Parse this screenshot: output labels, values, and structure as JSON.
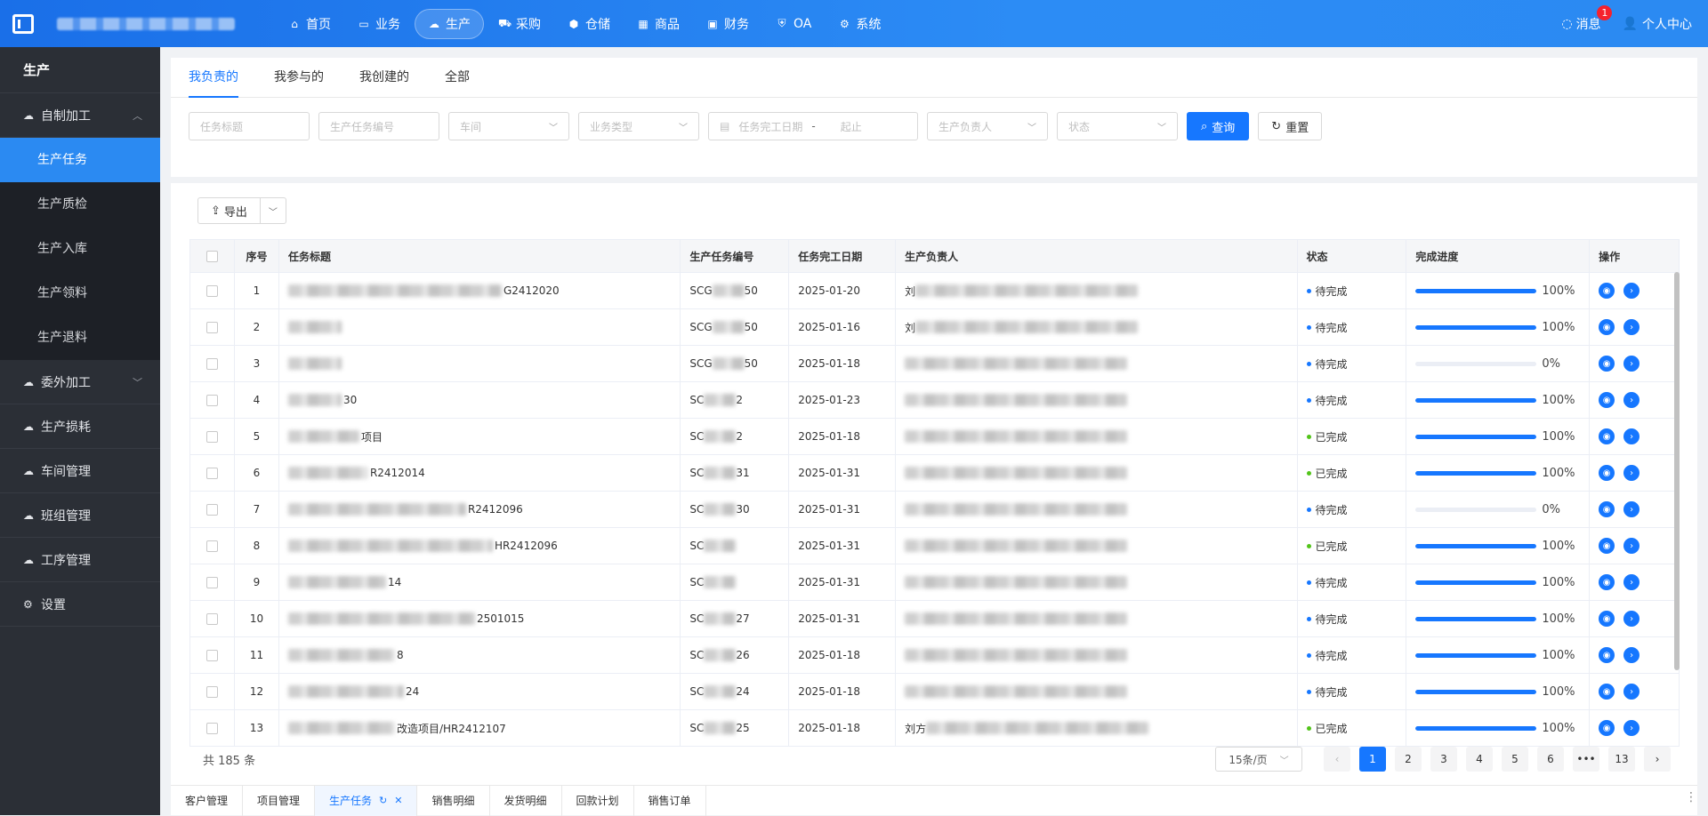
{
  "header": {
    "nav": [
      {
        "icon": "⌂",
        "label": "首页"
      },
      {
        "icon": "▭",
        "label": "业务"
      },
      {
        "icon": "☁",
        "label": "生产",
        "active": true
      },
      {
        "icon": "⛟",
        "label": "采购"
      },
      {
        "icon": "⬢",
        "label": "仓储"
      },
      {
        "icon": "▦",
        "label": "商品"
      },
      {
        "icon": "▣",
        "label": "财务"
      },
      {
        "icon": "⛨",
        "label": "OA"
      },
      {
        "icon": "⚙",
        "label": "系统"
      }
    ],
    "messages_label": "消息",
    "messages_badge": "1",
    "user_label": "个人中心"
  },
  "sidebar": {
    "title": "生产",
    "groups": [
      {
        "label": "自制加工",
        "expanded": true,
        "items": [
          "生产任务",
          "生产质检",
          "生产入库",
          "生产领料",
          "生产退料"
        ],
        "active_item": "生产任务"
      },
      {
        "label": "委外加工",
        "expanded": false
      },
      {
        "label": "生产损耗"
      },
      {
        "label": "车间管理"
      },
      {
        "label": "班组管理"
      },
      {
        "label": "工序管理"
      },
      {
        "label": "设置",
        "icon": "gear"
      }
    ]
  },
  "tabs": [
    {
      "label": "我负责的",
      "active": true
    },
    {
      "label": "我参与的"
    },
    {
      "label": "我创建的"
    },
    {
      "label": "全部"
    }
  ],
  "filters": {
    "task_title": "任务标题",
    "task_no": "生产任务编号",
    "workshop": "车间",
    "biz_type": "业务类型",
    "date_start": "任务完工日期",
    "date_sep": "-",
    "date_end": "起止",
    "owner": "生产负责人",
    "status": "状态",
    "query": "查询",
    "reset": "重置"
  },
  "export_label": "导出",
  "table": {
    "headers": [
      "序号",
      "任务标题",
      "生产任务编号",
      "任务完工日期",
      "生产负责人",
      "状态",
      "完成进度",
      "操作"
    ],
    "rows": [
      {
        "idx": "1",
        "title_suffix": "G2412020",
        "code_prefix": "SCG",
        "code_suffix": "50",
        "date": "2025-01-20",
        "owner_prefix": "刘",
        "status": "待完成",
        "progress": 100,
        "progress_label": "100%"
      },
      {
        "idx": "2",
        "title_suffix": "",
        "code_prefix": "SCG",
        "code_suffix": "50",
        "date": "2025-01-16",
        "owner_prefix": "刘",
        "status": "待完成",
        "progress": 100,
        "progress_label": "100%"
      },
      {
        "idx": "3",
        "title_suffix": "",
        "code_prefix": "SCG",
        "code_suffix": "50",
        "date": "2025-01-18",
        "owner_prefix": "",
        "status": "待完成",
        "progress": 0,
        "progress_label": "0%"
      },
      {
        "idx": "4",
        "title_suffix": "30",
        "code_prefix": "SC",
        "code_suffix": "2",
        "date": "2025-01-23",
        "owner_prefix": "",
        "status": "待完成",
        "progress": 100,
        "progress_label": "100%"
      },
      {
        "idx": "5",
        "title_suffix": "项目",
        "code_prefix": "SC",
        "code_suffix": "2",
        "date": "2025-01-18",
        "owner_prefix": "",
        "status": "已完成",
        "progress": 100,
        "progress_label": "100%"
      },
      {
        "idx": "6",
        "title_suffix": "R2412014",
        "code_prefix": "SC",
        "code_suffix": "31",
        "date": "2025-01-31",
        "owner_prefix": "",
        "status": "已完成",
        "progress": 100,
        "progress_label": "100%"
      },
      {
        "idx": "7",
        "title_suffix": "R2412096",
        "code_prefix": "SC",
        "code_suffix": "30",
        "date": "2025-01-31",
        "owner_prefix": "",
        "status": "待完成",
        "progress": 0,
        "progress_label": "0%"
      },
      {
        "idx": "8",
        "title_suffix": "HR2412096",
        "code_prefix": "SC",
        "code_suffix": "",
        "date": "2025-01-31",
        "owner_prefix": "",
        "status": "已完成",
        "progress": 100,
        "progress_label": "100%"
      },
      {
        "idx": "9",
        "title_suffix": "14",
        "code_prefix": "SC",
        "code_suffix": "",
        "date": "2025-01-31",
        "owner_prefix": "",
        "status": "待完成",
        "progress": 100,
        "progress_label": "100%"
      },
      {
        "idx": "10",
        "title_suffix": "2501015",
        "code_prefix": "SC",
        "code_suffix": "27",
        "date": "2025-01-31",
        "owner_prefix": "",
        "status": "待完成",
        "progress": 100,
        "progress_label": "100%"
      },
      {
        "idx": "11",
        "title_suffix": "8",
        "code_prefix": "SC",
        "code_suffix": "26",
        "date": "2025-01-18",
        "owner_prefix": "",
        "status": "待完成",
        "progress": 100,
        "progress_label": "100%"
      },
      {
        "idx": "12",
        "title_suffix": "24",
        "code_prefix": "SC",
        "code_suffix": "24",
        "date": "2025-01-18",
        "owner_prefix": "",
        "status": "待完成",
        "progress": 100,
        "progress_label": "100%"
      },
      {
        "idx": "13",
        "title_suffix": "改造项目/HR2412107",
        "code_prefix": "SC",
        "code_suffix": "25",
        "date": "2025-01-18",
        "owner_prefix": "刘方",
        "status": "已完成",
        "progress": 100,
        "progress_label": "100%"
      }
    ]
  },
  "footer": {
    "total": "共 185 条",
    "page_size": "15条/页",
    "pages": [
      "1",
      "2",
      "3",
      "4",
      "5",
      "6",
      "•••",
      "13"
    ],
    "current_page": "1"
  },
  "bottom_tabs": [
    {
      "label": "客户管理"
    },
    {
      "label": "项目管理"
    },
    {
      "label": "生产任务",
      "active": true
    },
    {
      "label": "销售明细"
    },
    {
      "label": "发货明细"
    },
    {
      "label": "回款计划"
    },
    {
      "label": "销售订单"
    }
  ],
  "colors": {
    "primary": "#1677ff",
    "pending": "#1677ff",
    "done": "#52c41a",
    "sidebar": "#2b2f36"
  }
}
